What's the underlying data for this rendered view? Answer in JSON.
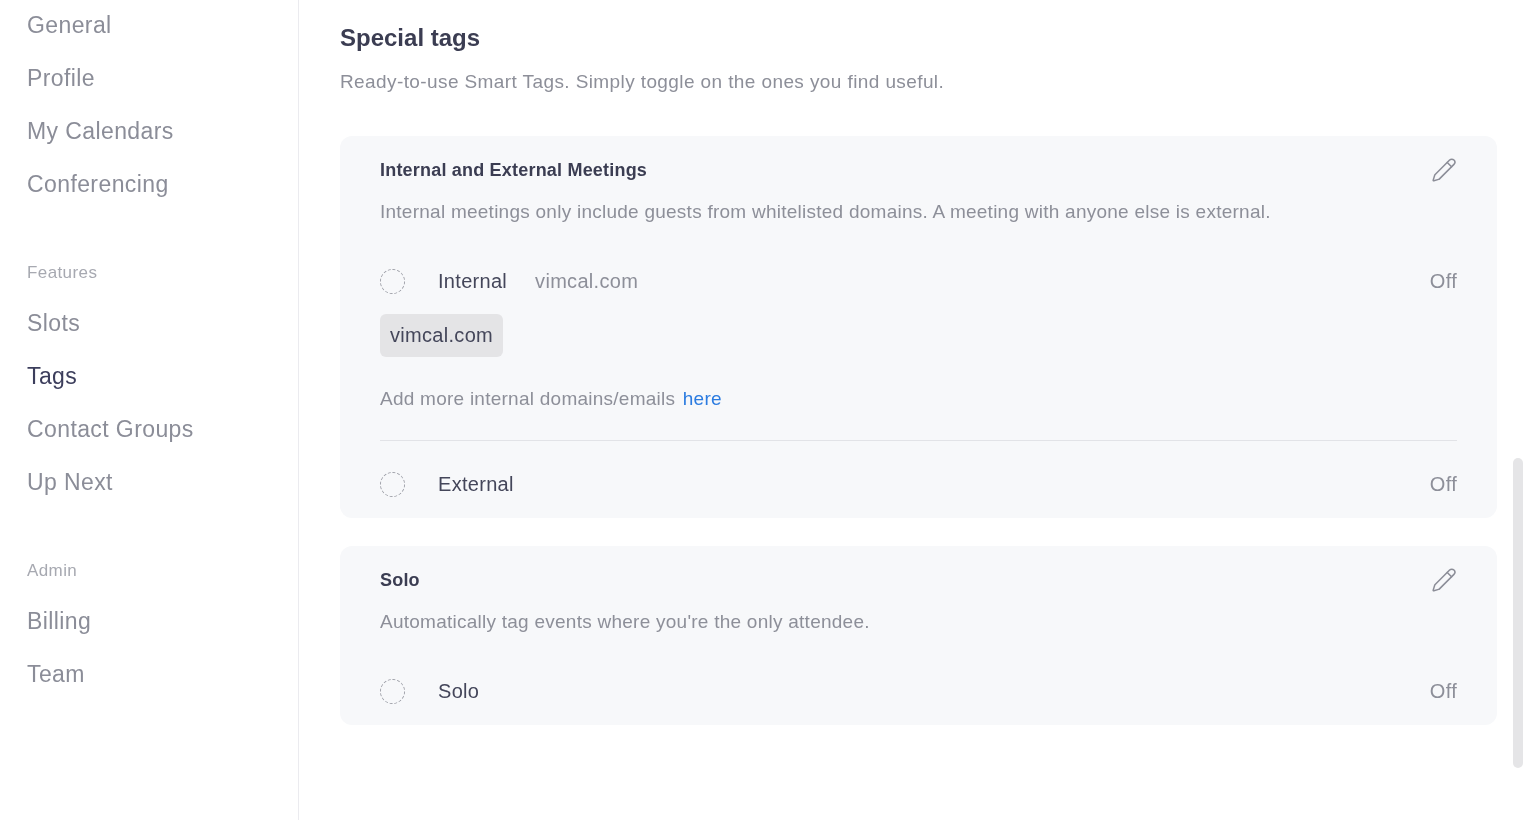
{
  "sidebar": {
    "sections": [
      {
        "items": [
          {
            "label": "General",
            "selected": false
          },
          {
            "label": "Profile",
            "selected": false
          },
          {
            "label": "My Calendars",
            "selected": false
          },
          {
            "label": "Conferencing",
            "selected": false
          }
        ]
      },
      {
        "heading": "Features",
        "items": [
          {
            "label": "Slots",
            "selected": false
          },
          {
            "label": "Tags",
            "selected": true
          },
          {
            "label": "Contact Groups",
            "selected": false
          },
          {
            "label": "Up Next",
            "selected": false
          }
        ]
      },
      {
        "heading": "Admin",
        "items": [
          {
            "label": "Billing",
            "selected": false
          },
          {
            "label": "Team",
            "selected": false
          }
        ]
      }
    ]
  },
  "page": {
    "title": "Special tags",
    "subtitle": "Ready-to-use Smart Tags. Simply toggle on the ones you find useful."
  },
  "cards": [
    {
      "title": "Internal and External Meetings",
      "description": "Internal meetings only include guests from whitelisted domains. A meeting with anyone else is external.",
      "options": [
        {
          "label": "Internal",
          "domain": "vimcal.com",
          "checked": false,
          "status": "Off",
          "chips": [
            "vimcal.com"
          ],
          "hint": {
            "text": "Add more internal domains/emails",
            "link": "here"
          }
        },
        {
          "label": "External",
          "checked": false,
          "status": "Off"
        }
      ]
    },
    {
      "title": "Solo",
      "description": "Automatically tag events where you're the only attendee.",
      "options": [
        {
          "label": "Solo",
          "checked": false,
          "status": "Off"
        }
      ]
    }
  ]
}
